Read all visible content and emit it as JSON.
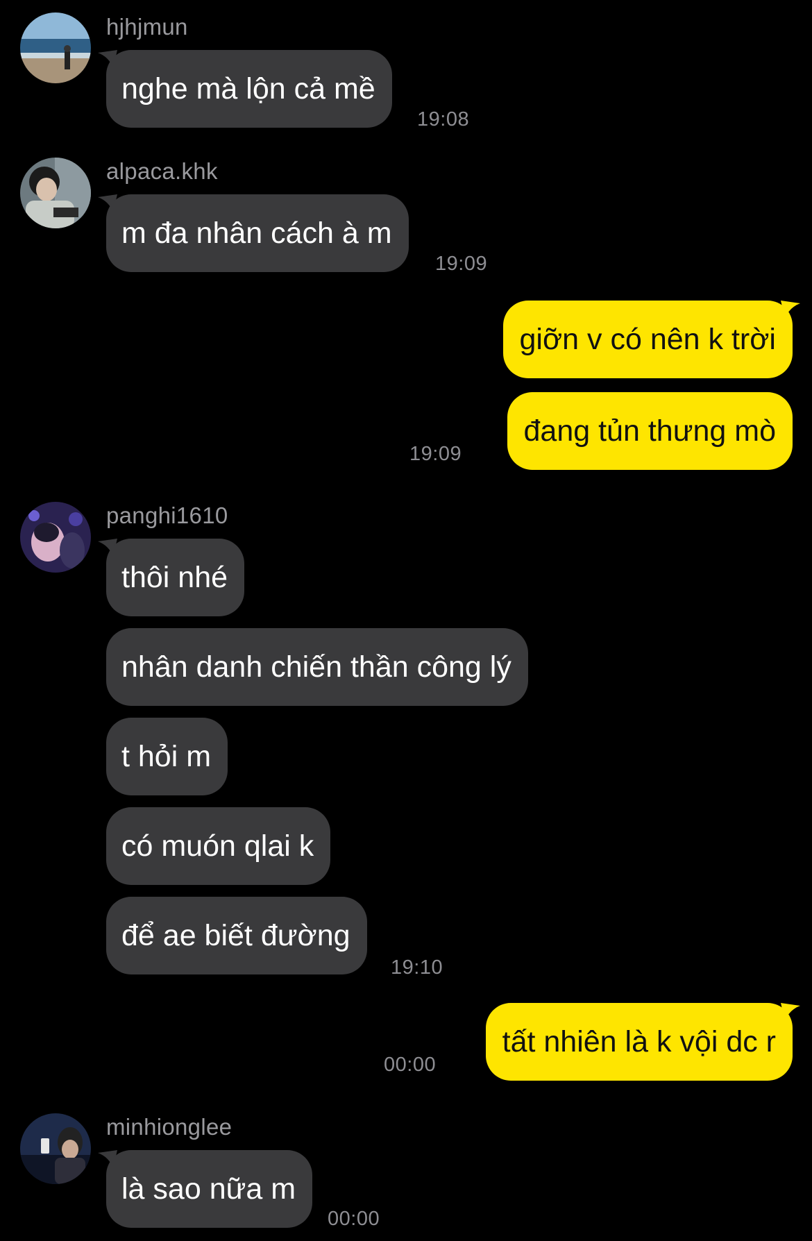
{
  "messages": [
    {
      "sender": "hjhjmun",
      "text": "nghe mà lộn cả mề",
      "time": "19:08"
    },
    {
      "sender": "alpaca.khk",
      "text": "m đa nhân cách à m",
      "time": "19:09"
    },
    {
      "mine": [
        "giỡn v có nên k trời",
        "đang tủn thưng mò"
      ],
      "time": "19:09"
    },
    {
      "sender": "panghi1610",
      "texts": [
        "thôi nhé",
        "nhân danh chiến thần công lý",
        "t hỏi m",
        "có muón qlai k",
        "để ae biết đường"
      ],
      "time": "19:10"
    },
    {
      "mine": [
        "tất nhiên là k vội dc r"
      ],
      "time": "00:00"
    },
    {
      "sender": "minhionglee",
      "text": "là sao nữa m",
      "time": "00:00"
    }
  ],
  "colors": {
    "background": "#000000",
    "incoming_bubble": "#3a3a3c",
    "outgoing_bubble": "#fee500",
    "meta_text": "#8e8e93"
  }
}
